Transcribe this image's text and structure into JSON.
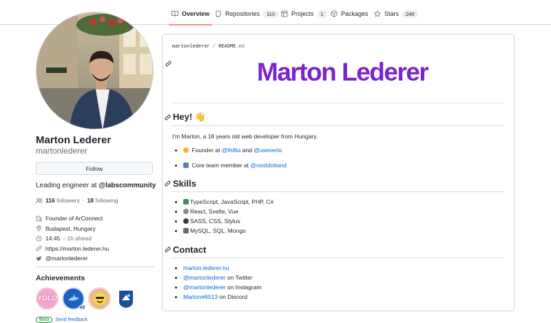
{
  "tabs": [
    {
      "label": "Overview",
      "icon": "book-icon",
      "active": true
    },
    {
      "label": "Repositories",
      "count": "110",
      "icon": "repo-icon"
    },
    {
      "label": "Projects",
      "count": "1",
      "icon": "table-icon"
    },
    {
      "label": "Packages",
      "icon": "package-icon"
    },
    {
      "label": "Stars",
      "count": "240",
      "icon": "star-icon"
    }
  ],
  "profile": {
    "name": "Marton Lederer",
    "login": "martonlederer",
    "follow_label": "Follow",
    "bio_prefix": "Leading engineer at ",
    "bio_org": "@labscommunity",
    "followers_count": "116",
    "followers_label": "followers",
    "dot": "·",
    "following_count": "18",
    "following_label": "following",
    "details": [
      {
        "icon": "organization-icon",
        "text": "Founder of ArConnect"
      },
      {
        "icon": "location-icon",
        "text": "Budapest, Hungary"
      },
      {
        "icon": "clock-icon",
        "text": "14:45",
        "extra": "- 1h ahead"
      },
      {
        "icon": "link-icon",
        "text": "https://marton.lederer.hu"
      },
      {
        "icon": "twitter-icon",
        "text": "@martonlederer"
      }
    ]
  },
  "achievements": {
    "title": "Achievements",
    "badges": [
      {
        "name": "yolo",
        "label": "YOLO"
      },
      {
        "name": "pull-shark",
        "multiplier": "x3"
      },
      {
        "name": "quickdraw"
      },
      {
        "name": "arctic-code-vault"
      }
    ],
    "beta_label": "Beta",
    "feedback_label": "Send feedback"
  },
  "readme": {
    "crumb_owner": "martonlederer",
    "crumb_sep": "/",
    "crumb_file": "README",
    "crumb_ext": ".md",
    "banner": "Marton Lederer",
    "hey_heading": "Hey! 👋",
    "intro": "I'm Marton, a 18 years old web developer from Hungary.",
    "roles": [
      {
        "prefix": "Founder at ",
        "link1": "@th8ta",
        "mid": " and ",
        "link2": "@useverto"
      },
      {
        "prefix": "Core team member at ",
        "link1": "@nestdotland"
      }
    ],
    "skills_heading": "Skills",
    "skills": [
      "TypeScript, JavaScript, PHP, C#",
      "React, Svelte, Vue",
      "SASS, CSS, Stylus",
      "MySQL, SQL, Mongo"
    ],
    "contact_heading": "Contact",
    "contacts": [
      {
        "link": "marton.lederer.hu",
        "suffix": ""
      },
      {
        "link": "@martonlederer",
        "suffix": " on Twitter"
      },
      {
        "link": "@martonlederer",
        "suffix": " on Instagram"
      },
      {
        "link": "Marton#6513",
        "suffix": " on Discord"
      }
    ]
  },
  "colors": {
    "accent_link": "#0969da",
    "banner": "#7e22ce",
    "tab_underline": "#fd8c73"
  }
}
